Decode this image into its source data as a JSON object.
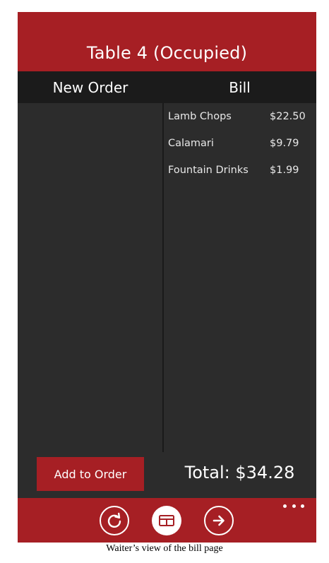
{
  "header": {
    "title": "Table 4 (Occupied)"
  },
  "tabs": {
    "new_order": "New Order",
    "bill": "Bill"
  },
  "bill": {
    "items": [
      {
        "name": "Lamb Chops",
        "price": "$22.50"
      },
      {
        "name": "Calamari",
        "price": "$9.79"
      },
      {
        "name": "Fountain Drinks",
        "price": "$1.99"
      }
    ],
    "total": "Total: $34.28"
  },
  "actions": {
    "add_to_order": "Add to Order"
  },
  "app_bar": {
    "icons": [
      "refresh-icon",
      "bill-icon",
      "arrow-right-icon",
      "more-icon"
    ]
  },
  "caption": "Waiter’s view of the bill page",
  "colors": {
    "accent": "#a61f24",
    "panel": "#2c2c2c",
    "tab_bar": "#1b1b1b"
  }
}
